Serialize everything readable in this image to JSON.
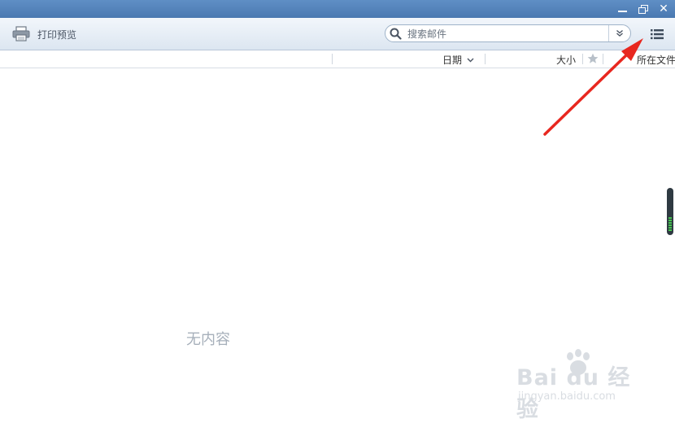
{
  "window": {
    "controls": {
      "minimize": "minimize-icon",
      "restore": "restore-icon",
      "close": "✕"
    }
  },
  "toolbar": {
    "print_preview_label": "打印预览",
    "search": {
      "placeholder": "搜索邮件",
      "value": ""
    },
    "list_view_icon": "list-view-icon"
  },
  "columns": {
    "date": "日期",
    "size": "大小",
    "folder": "所在文件"
  },
  "main": {
    "empty_message": "无内容"
  },
  "watermark": {
    "main": "Bai du 经验",
    "sub": "jingyan.baidu.com"
  },
  "colors": {
    "titlebar": "#4a79b1",
    "annotation_arrow": "#e8271f",
    "scroll_grip": "#45c34f"
  }
}
